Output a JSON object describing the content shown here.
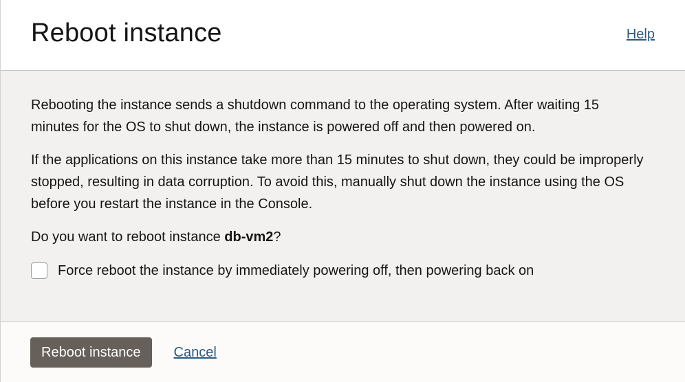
{
  "dialog": {
    "title": "Reboot instance",
    "help_label": "Help"
  },
  "body": {
    "paragraph_1": "Rebooting the instance sends a shutdown command to the operating system. After waiting 15 minutes for the OS to shut down, the instance is powered off and then powered on.",
    "paragraph_2": "If the applications on this instance take more than 15 minutes to shut down, they could be improperly stopped, resulting in data corruption. To avoid this, manually shut down the instance using the OS before you restart the instance in the Console.",
    "question_prefix": "Do you want to reboot instance ",
    "instance_name": "db-vm2",
    "question_suffix": "?",
    "force_reboot_label": "Force reboot the instance by immediately powering off, then powering back on",
    "force_reboot_checked": false
  },
  "footer": {
    "primary_label": "Reboot instance",
    "cancel_label": "Cancel"
  },
  "colors": {
    "primary_button": "#665f5a",
    "link": "#2c5a7e",
    "body_background": "#f2f1f0"
  }
}
